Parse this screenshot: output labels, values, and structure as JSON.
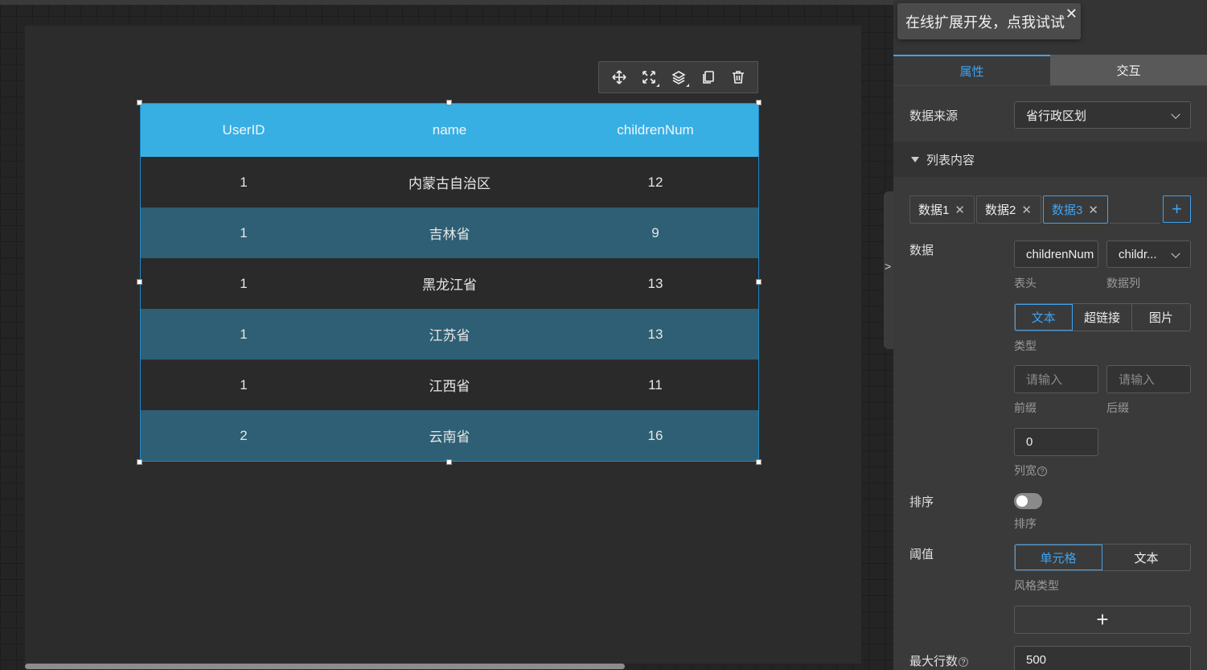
{
  "toolbar": {
    "icons": [
      "move-icon",
      "fullscreen-icon",
      "layers-icon",
      "copy-icon",
      "delete-icon"
    ]
  },
  "table": {
    "columns": [
      "UserID",
      "name",
      "childrenNum"
    ],
    "rows": [
      [
        "1",
        "内蒙古自治区",
        "12"
      ],
      [
        "1",
        "吉林省",
        "9"
      ],
      [
        "1",
        "黑龙江省",
        "13"
      ],
      [
        "1",
        "江苏省",
        "13"
      ],
      [
        "1",
        "江西省",
        "11"
      ],
      [
        "2",
        "云南省",
        "16"
      ]
    ],
    "colors": {
      "header": "#38afe3",
      "row_even": "#2a2a2a",
      "row_odd": "#2e5f74"
    }
  },
  "tooltip": {
    "text": "在线扩展开发，点我试试",
    "close": "✕"
  },
  "tabs": {
    "props": "属性",
    "interact": "交互"
  },
  "panel": {
    "data_source_label": "数据来源",
    "data_source_value": "省行政区划",
    "section_title": "列表内容",
    "chips": [
      "数据1",
      "数据2",
      "数据3"
    ],
    "chip_close": "✕",
    "add": "+",
    "data_label": "数据",
    "header_value": "childrenNum",
    "header_sub": "表头",
    "column_value": "childr...",
    "column_sub": "数据列",
    "type_options": [
      "文本",
      "超链接",
      "图片"
    ],
    "type_sub": "类型",
    "prefix_placeholder": "请输入",
    "prefix_sub": "前缀",
    "suffix_placeholder": "请输入",
    "suffix_sub": "后缀",
    "width_value": "0",
    "width_sub": "列宽",
    "help": "?",
    "sort_label": "排序",
    "sort_sub": "排序",
    "threshold_label": "阈值",
    "style_options": [
      "单元格",
      "文本"
    ],
    "style_sub": "风格类型",
    "plus": "+",
    "max_rows_label": "最大行数",
    "max_rows_value": "500"
  },
  "collapse_arrow": ">"
}
